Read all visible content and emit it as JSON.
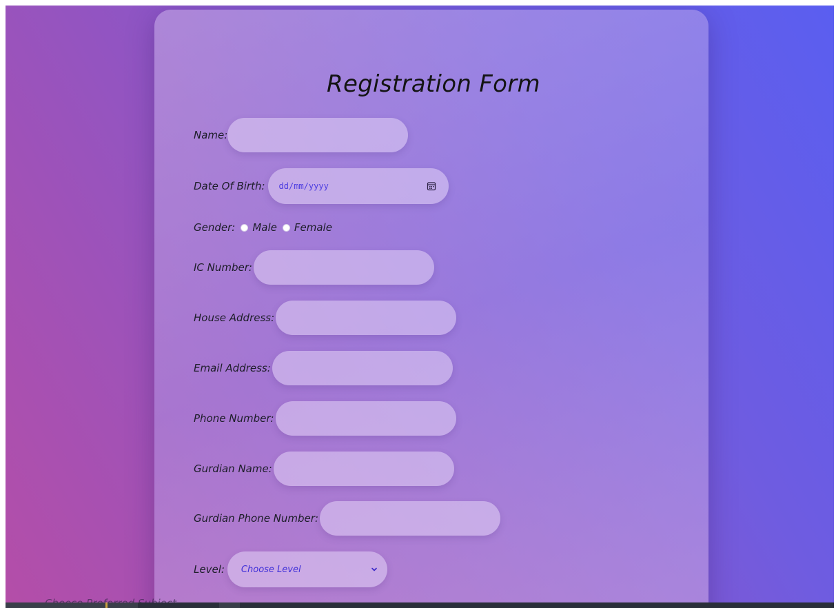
{
  "form": {
    "title": "Registration Form",
    "fields": {
      "name": {
        "label": "Name:",
        "value": ""
      },
      "dob": {
        "label": "Date Of Birth:",
        "placeholder": "dd/mm/yyyy"
      },
      "gender": {
        "label": "Gender:",
        "option_male": "Male",
        "option_female": "Female"
      },
      "ic_number": {
        "label": "IC Number:",
        "value": ""
      },
      "house_address": {
        "label": "House Address:",
        "value": ""
      },
      "email_address": {
        "label": "Email Address:",
        "value": ""
      },
      "phone_number": {
        "label": "Phone Number:",
        "value": ""
      },
      "gurdian_name": {
        "label": "Gurdian Name:",
        "value": ""
      },
      "gurdian_phone": {
        "label": "Gurdian Phone Number:",
        "value": ""
      },
      "level": {
        "label": "Level:",
        "selected": "Choose Level"
      }
    },
    "cutoff_text": "Choose Preferred Subject"
  },
  "icons": {
    "calendar": "calendar-icon",
    "chevron": "chevron-down-icon"
  },
  "colors": {
    "accent_text": "#4c3ce0",
    "bg_start": "#b44ea8",
    "bg_end": "#5a5ef0"
  }
}
